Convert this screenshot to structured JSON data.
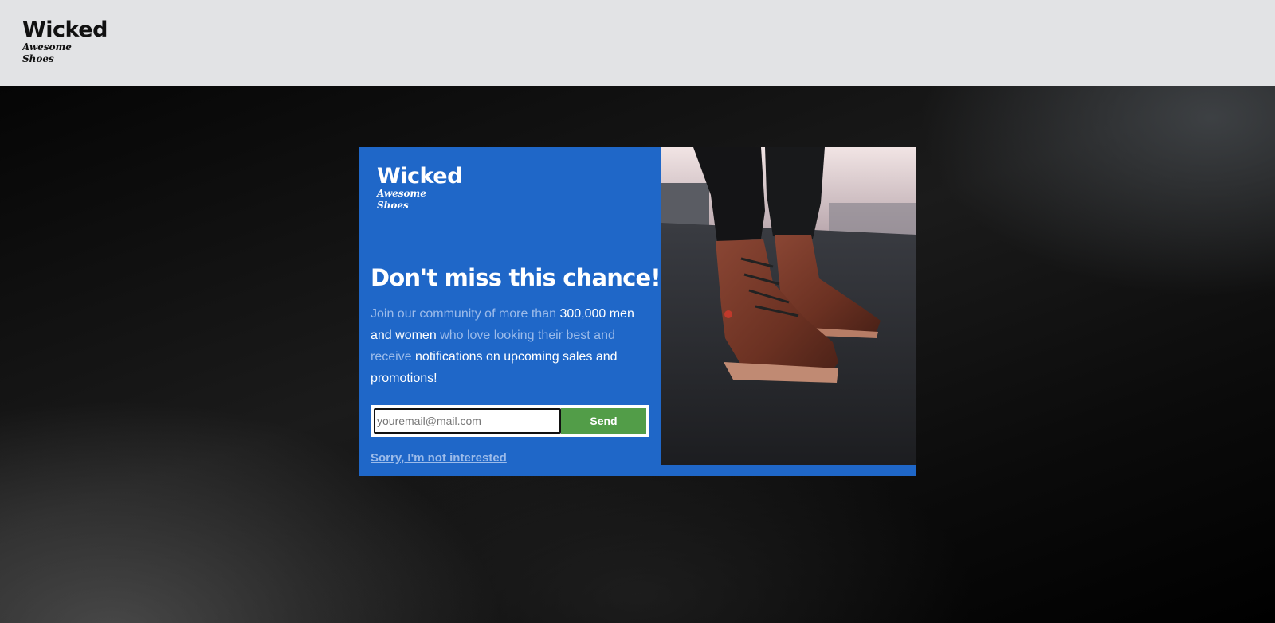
{
  "header": {
    "logo": {
      "wordmark": "Wicked",
      "script_line1": "Awesome",
      "script_line2": "Shoes"
    }
  },
  "modal": {
    "logo": {
      "wordmark": "Wicked",
      "script_line1": "Awesome",
      "script_line2": "Shoes"
    },
    "headline": "Don't miss this chance!",
    "body": {
      "part1": "Join our community of more than ",
      "part2": "300,000 men and women",
      "part3": " who love looking their best and receive ",
      "part4": "notifications on upcoming sales and promotions!"
    },
    "form": {
      "email_placeholder": "youremail@mail.com",
      "send_label": "Send"
    },
    "dismiss_label": "Sorry, I'm not interested",
    "photo_icon": "boots-photo"
  },
  "colors": {
    "header_bg": "#e2e3e5",
    "modal_bg": "#1f67c8",
    "send_button": "#529d48",
    "muted_text": "#9bbbea"
  }
}
